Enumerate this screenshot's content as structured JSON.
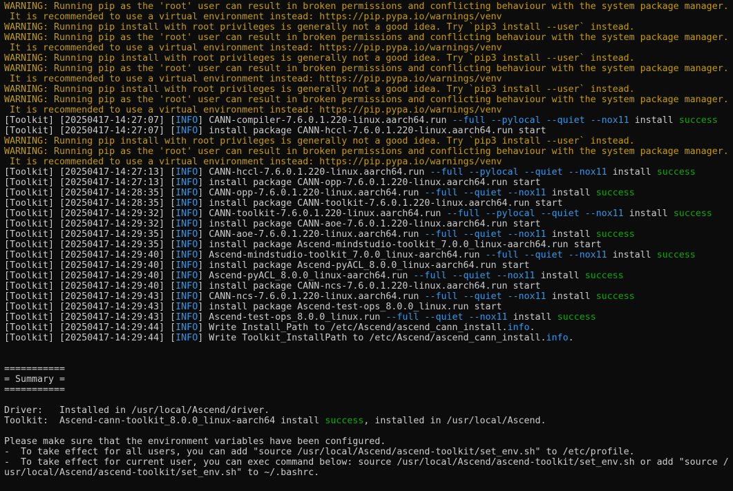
{
  "colors": {
    "background": "#0c0c0c",
    "default": "#cccccc",
    "warning": "#c19c00",
    "info": "#3a96dd",
    "success": "#13a10e",
    "cmd": "#3a96dd"
  },
  "lines": [
    [
      {
        "t": "WARNING: Running pip as the 'root' user can result in broken permissions and conflicting behaviour with the system package manager.",
        "s": "warning"
      }
    ],
    [
      {
        "t": " It is recommended to use a virtual environment instead: https://pip.pypa.io/warnings/venv",
        "s": "warning"
      }
    ],
    [
      {
        "t": "WARNING: Running pip install with root privileges is generally not a good idea. Try `pip3 install --user` instead.",
        "s": "warning"
      }
    ],
    [
      {
        "t": "WARNING: Running pip as the 'root' user can result in broken permissions and conflicting behaviour with the system package manager.",
        "s": "warning"
      }
    ],
    [
      {
        "t": " It is recommended to use a virtual environment instead: https://pip.pypa.io/warnings/venv",
        "s": "warning"
      }
    ],
    [
      {
        "t": "WARNING: Running pip install with root privileges is generally not a good idea. Try `pip3 install --user` instead.",
        "s": "warning"
      }
    ],
    [
      {
        "t": "WARNING: Running pip as the 'root' user can result in broken permissions and conflicting behaviour with the system package manager.",
        "s": "warning"
      }
    ],
    [
      {
        "t": " It is recommended to use a virtual environment instead: https://pip.pypa.io/warnings/venv",
        "s": "warning"
      }
    ],
    [
      {
        "t": "WARNING: Running pip install with root privileges is generally not a good idea. Try `pip3 install --user` instead.",
        "s": "warning"
      }
    ],
    [
      {
        "t": "WARNING: Running pip as the 'root' user can result in broken permissions and conflicting behaviour with the system package manager.",
        "s": "warning"
      }
    ],
    [
      {
        "t": " It is recommended to use a virtual environment instead: https://pip.pypa.io/warnings/venv",
        "s": "warning"
      }
    ],
    [
      {
        "t": "[Toolkit] [20250417-14:27:07] [",
        "s": "default"
      },
      {
        "t": "INFO",
        "s": "info"
      },
      {
        "t": "] CANN-compiler-7.6.0.1.220-linux.aarch64.run ",
        "s": "default"
      },
      {
        "t": "--full --pylocal --quiet --nox11",
        "s": "cmd"
      },
      {
        "t": " install ",
        "s": "default"
      },
      {
        "t": "success",
        "s": "success"
      }
    ],
    [
      {
        "t": "[Toolkit] [20250417-14:27:07] [",
        "s": "default"
      },
      {
        "t": "INFO",
        "s": "info"
      },
      {
        "t": "] install package CANN-hccl-7.6.0.1.220-linux.aarch64.run start",
        "s": "default"
      }
    ],
    [
      {
        "t": "WARNING: Running pip install with root privileges is generally not a good idea. Try `pip3 install --user` instead.",
        "s": "warning"
      }
    ],
    [
      {
        "t": "WARNING: Running pip as the 'root' user can result in broken permissions and conflicting behaviour with the system package manager.",
        "s": "warning"
      }
    ],
    [
      {
        "t": " It is recommended to use a virtual environment instead: https://pip.pypa.io/warnings/venv",
        "s": "warning"
      }
    ],
    [
      {
        "t": "[Toolkit] [20250417-14:27:13] [",
        "s": "default"
      },
      {
        "t": "INFO",
        "s": "info"
      },
      {
        "t": "] CANN-hccl-7.6.0.1.220-linux.aarch64.run ",
        "s": "default"
      },
      {
        "t": "--full --pylocal --quiet --nox11",
        "s": "cmd"
      },
      {
        "t": " install ",
        "s": "default"
      },
      {
        "t": "success",
        "s": "success"
      }
    ],
    [
      {
        "t": "[Toolkit] [20250417-14:27:13] [",
        "s": "default"
      },
      {
        "t": "INFO",
        "s": "info"
      },
      {
        "t": "] install package CANN-opp-7.6.0.1.220-linux.aarch64.run start",
        "s": "default"
      }
    ],
    [
      {
        "t": "[Toolkit] [20250417-14:28:35] [",
        "s": "default"
      },
      {
        "t": "INFO",
        "s": "info"
      },
      {
        "t": "] CANN-opp-7.6.0.1.220-linux.aarch64.run ",
        "s": "default"
      },
      {
        "t": "--full --quiet --nox11",
        "s": "cmd"
      },
      {
        "t": " install ",
        "s": "default"
      },
      {
        "t": "success",
        "s": "success"
      }
    ],
    [
      {
        "t": "[Toolkit] [20250417-14:28:35] [",
        "s": "default"
      },
      {
        "t": "INFO",
        "s": "info"
      },
      {
        "t": "] install package CANN-toolkit-7.6.0.1.220-linux.aarch64.run start",
        "s": "default"
      }
    ],
    [
      {
        "t": "[Toolkit] [20250417-14:29:32] [",
        "s": "default"
      },
      {
        "t": "INFO",
        "s": "info"
      },
      {
        "t": "] CANN-toolkit-7.6.0.1.220-linux.aarch64.run ",
        "s": "default"
      },
      {
        "t": "--full --pylocal --quiet --nox11",
        "s": "cmd"
      },
      {
        "t": " install ",
        "s": "default"
      },
      {
        "t": "success",
        "s": "success"
      }
    ],
    [
      {
        "t": "[Toolkit] [20250417-14:29:32] [",
        "s": "default"
      },
      {
        "t": "INFO",
        "s": "info"
      },
      {
        "t": "] install package CANN-aoe-7.6.0.1.220-linux.aarch64.run start",
        "s": "default"
      }
    ],
    [
      {
        "t": "[Toolkit] [20250417-14:29:35] [",
        "s": "default"
      },
      {
        "t": "INFO",
        "s": "info"
      },
      {
        "t": "] CANN-aoe-7.6.0.1.220-linux.aarch64.run ",
        "s": "default"
      },
      {
        "t": "--full --quiet --nox11",
        "s": "cmd"
      },
      {
        "t": " install ",
        "s": "default"
      },
      {
        "t": "success",
        "s": "success"
      }
    ],
    [
      {
        "t": "[Toolkit] [20250417-14:29:35] [",
        "s": "default"
      },
      {
        "t": "INFO",
        "s": "info"
      },
      {
        "t": "] install package Ascend-mindstudio-toolkit_7.0.0_linux-aarch64.run start",
        "s": "default"
      }
    ],
    [
      {
        "t": "[Toolkit] [20250417-14:29:40] [",
        "s": "default"
      },
      {
        "t": "INFO",
        "s": "info"
      },
      {
        "t": "] Ascend-mindstudio-toolkit_7.0.0_linux-aarch64.run ",
        "s": "default"
      },
      {
        "t": "--full --quiet --nox11",
        "s": "cmd"
      },
      {
        "t": " install ",
        "s": "default"
      },
      {
        "t": "success",
        "s": "success"
      }
    ],
    [
      {
        "t": "[Toolkit] [20250417-14:29:40] [",
        "s": "default"
      },
      {
        "t": "INFO",
        "s": "info"
      },
      {
        "t": "] install package Ascend-pyACL_8.0.0_linux-aarch64.run start",
        "s": "default"
      }
    ],
    [
      {
        "t": "[Toolkit] [20250417-14:29:40] [",
        "s": "default"
      },
      {
        "t": "INFO",
        "s": "info"
      },
      {
        "t": "] Ascend-pyACL_8.0.0_linux-aarch64.run ",
        "s": "default"
      },
      {
        "t": "--full --quiet --nox11",
        "s": "cmd"
      },
      {
        "t": " install ",
        "s": "default"
      },
      {
        "t": "success",
        "s": "success"
      }
    ],
    [
      {
        "t": "[Toolkit] [20250417-14:29:40] [",
        "s": "default"
      },
      {
        "t": "INFO",
        "s": "info"
      },
      {
        "t": "] install package CANN-ncs-7.6.0.1.220-linux.aarch64.run start",
        "s": "default"
      }
    ],
    [
      {
        "t": "[Toolkit] [20250417-14:29:43] [",
        "s": "default"
      },
      {
        "t": "INFO",
        "s": "info"
      },
      {
        "t": "] CANN-ncs-7.6.0.1.220-linux.aarch64.run ",
        "s": "default"
      },
      {
        "t": "--full --quiet --nox11",
        "s": "cmd"
      },
      {
        "t": " install ",
        "s": "default"
      },
      {
        "t": "success",
        "s": "success"
      }
    ],
    [
      {
        "t": "[Toolkit] [20250417-14:29:43] [",
        "s": "default"
      },
      {
        "t": "INFO",
        "s": "info"
      },
      {
        "t": "] install package Ascend-test-ops_8.0.0_linux.run start",
        "s": "default"
      }
    ],
    [
      {
        "t": "[Toolkit] [20250417-14:29:43] [",
        "s": "default"
      },
      {
        "t": "INFO",
        "s": "info"
      },
      {
        "t": "] Ascend-test-ops_8.0.0_linux.run ",
        "s": "default"
      },
      {
        "t": "--full --quiet --nox11",
        "s": "cmd"
      },
      {
        "t": " install ",
        "s": "default"
      },
      {
        "t": "success",
        "s": "success"
      }
    ],
    [
      {
        "t": "[Toolkit] [20250417-14:29:44] [",
        "s": "default"
      },
      {
        "t": "INFO",
        "s": "info"
      },
      {
        "t": "] Write Install_Path to /etc/Ascend/ascend_cann_install.",
        "s": "default"
      },
      {
        "t": "info",
        "s": "info"
      },
      {
        "t": ".",
        "s": "default"
      }
    ],
    [
      {
        "t": "[Toolkit] [20250417-14:29:44] [",
        "s": "default"
      },
      {
        "t": "INFO",
        "s": "info"
      },
      {
        "t": "] Write Toolkit_InstallPath to /etc/Ascend/ascend_cann_install.",
        "s": "default"
      },
      {
        "t": "info",
        "s": "info"
      },
      {
        "t": ".",
        "s": "default"
      }
    ],
    [],
    [],
    [
      {
        "t": "===========",
        "s": "default"
      }
    ],
    [
      {
        "t": "= Summary =",
        "s": "default"
      }
    ],
    [
      {
        "t": "===========",
        "s": "default"
      }
    ],
    [],
    [
      {
        "t": "Driver:   Installed in /usr/local/Ascend/driver.",
        "s": "default"
      }
    ],
    [
      {
        "t": "Toolkit:  Ascend-cann-toolkit_8.0.0_linux-aarch64 install ",
        "s": "default"
      },
      {
        "t": "success",
        "s": "success"
      },
      {
        "t": ", installed in /usr/local/Ascend.",
        "s": "default"
      }
    ],
    [],
    [
      {
        "t": "Please make sure that the environment variables have been configured.",
        "s": "default"
      }
    ],
    [
      {
        "t": "-  To take effect for all users, you can add \"source /usr/local/Ascend/ascend-toolkit/set_env.sh\" to /etc/profile.",
        "s": "default"
      }
    ],
    [
      {
        "t": "-  To take effect for current user, you can exec command below: source /usr/local/Ascend/ascend-toolkit/set_env.sh or add \"source /",
        "s": "default"
      }
    ],
    [
      {
        "t": "usr/local/Ascend/ascend-toolkit/set_env.sh\" to ~/.bashrc.",
        "s": "default"
      }
    ]
  ]
}
